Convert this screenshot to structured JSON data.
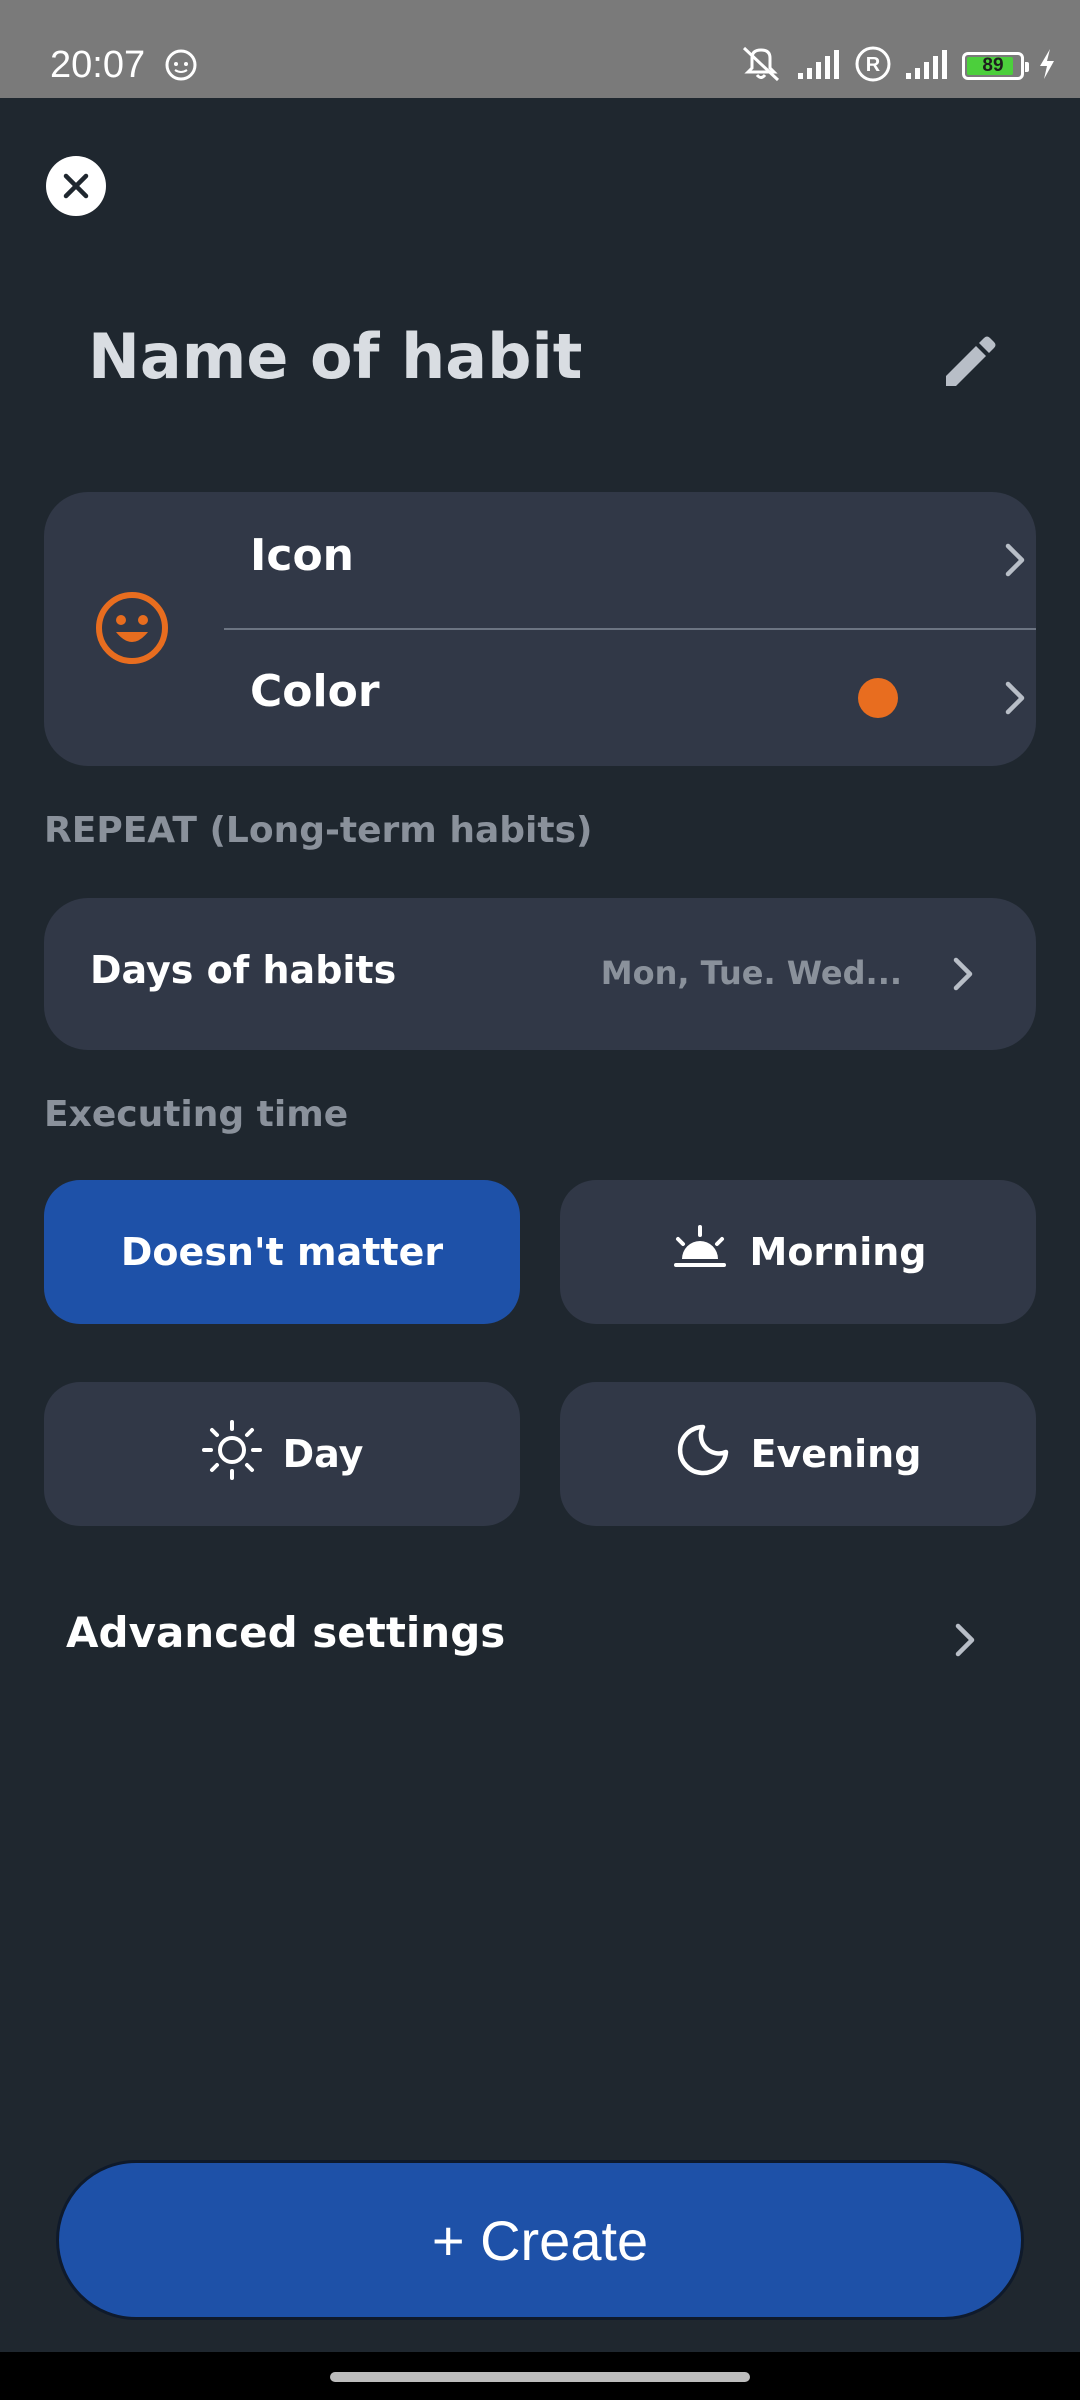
{
  "status_bar": {
    "time": "20:07",
    "battery_level": "89",
    "battery_fraction": 0.89
  },
  "header": {
    "title": "Name of habit"
  },
  "appearance": {
    "icon_label": "Icon",
    "color_label": "Color",
    "selected_icon": "smiley-face-icon",
    "selected_color": "#e86d1f"
  },
  "repeat": {
    "section_label": "REPEAT (Long-term habits)",
    "days_label": "Days of habits",
    "days_value": "Mon, Tue. Wed..."
  },
  "executing_time": {
    "section_label": "Executing time",
    "options": [
      {
        "label": "Doesn't matter",
        "icon": "",
        "selected": true
      },
      {
        "label": "Morning",
        "icon": "sunrise-icon",
        "selected": false
      },
      {
        "label": "Day",
        "icon": "sun-icon",
        "selected": false
      },
      {
        "label": "Evening",
        "icon": "moon-icon",
        "selected": false
      }
    ]
  },
  "advanced": {
    "label": "Advanced settings"
  },
  "create_button": {
    "label": "+ Create"
  },
  "colors": {
    "background": "#1f272f",
    "card": "#313847",
    "accent_blue": "#1e51a8",
    "accent_orange": "#e86d1f"
  }
}
